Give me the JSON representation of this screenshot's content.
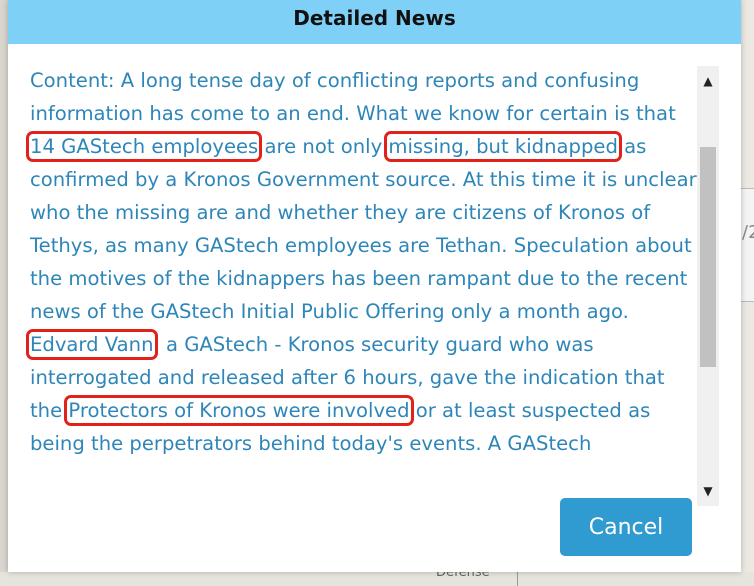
{
  "background": {
    "right_edge_text": "/2",
    "bottom_text": "Defense"
  },
  "dialog": {
    "title": "Detailed News",
    "content_segments": [
      {
        "text": "Content: A long tense day of conflicting reports and confusing information has come to an end. What we know for certain is that ",
        "highlight": false
      },
      {
        "text": "14 GAStech employees",
        "highlight": true
      },
      {
        "text": " are not only ",
        "highlight": false
      },
      {
        "text": "missing, but kidnapped",
        "highlight": true
      },
      {
        "text": " as confirmed by a Kronos Government source. At this time it is unclear who the missing are and whether they are citizens of Kronos of Tethys, as many GAStech employees are Tethan. Speculation about the motives of the kidnappers has been rampant due to the recent news of the GAStech Initial Public Offering only a month ago. ",
        "highlight": false
      },
      {
        "text": "Edvard Vann",
        "highlight": true
      },
      {
        "text": ", a GAStech - Kronos security guard who was interrogated and released after 6 hours, gave the indication that the ",
        "highlight": false
      },
      {
        "text": "Protectors of Kronos were involved",
        "highlight": true
      },
      {
        "text": " or at least suspected as being the perpetrators behind today's events. A GAStech",
        "highlight": false
      }
    ],
    "cancel_label": "Cancel",
    "scroll": {
      "up_icon": "▲",
      "down_icon": "▼"
    }
  },
  "colors": {
    "header_bg": "#7fd0f6",
    "text": "#2e86b8",
    "highlight_border": "#e0221b",
    "button_bg": "#2f9bd0"
  }
}
